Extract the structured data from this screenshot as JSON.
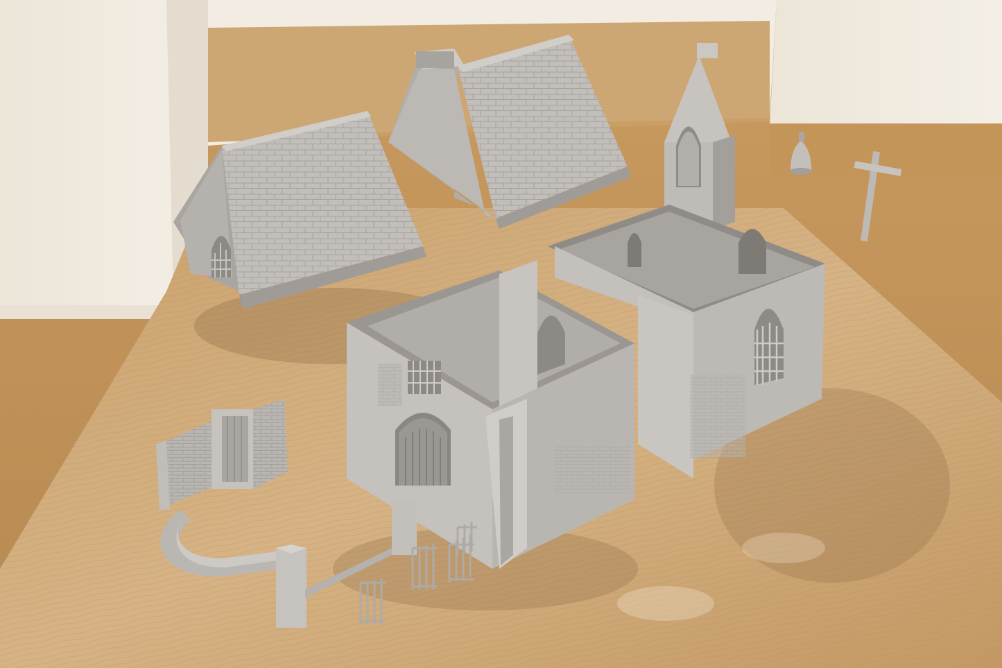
{
  "scene": {
    "description_colors": {
      "wall_cream": "#efe8dc",
      "floor_wood": "#c79a62",
      "floor_dark": "#a97a45",
      "table_wood": "#cda776",
      "table_shadow": "#a88658",
      "model_grey": "#bdb8b4",
      "model_light": "#d4d0cc",
      "model_dark": "#8f8b88",
      "model_shadow": "#6f6b68"
    },
    "objects": [
      "left-roof-piece",
      "right-roof-piece",
      "bell-tower",
      "bell",
      "cross",
      "nave-walls",
      "porch-walls",
      "gate-wall",
      "curved-wall",
      "iron-gates"
    ]
  }
}
